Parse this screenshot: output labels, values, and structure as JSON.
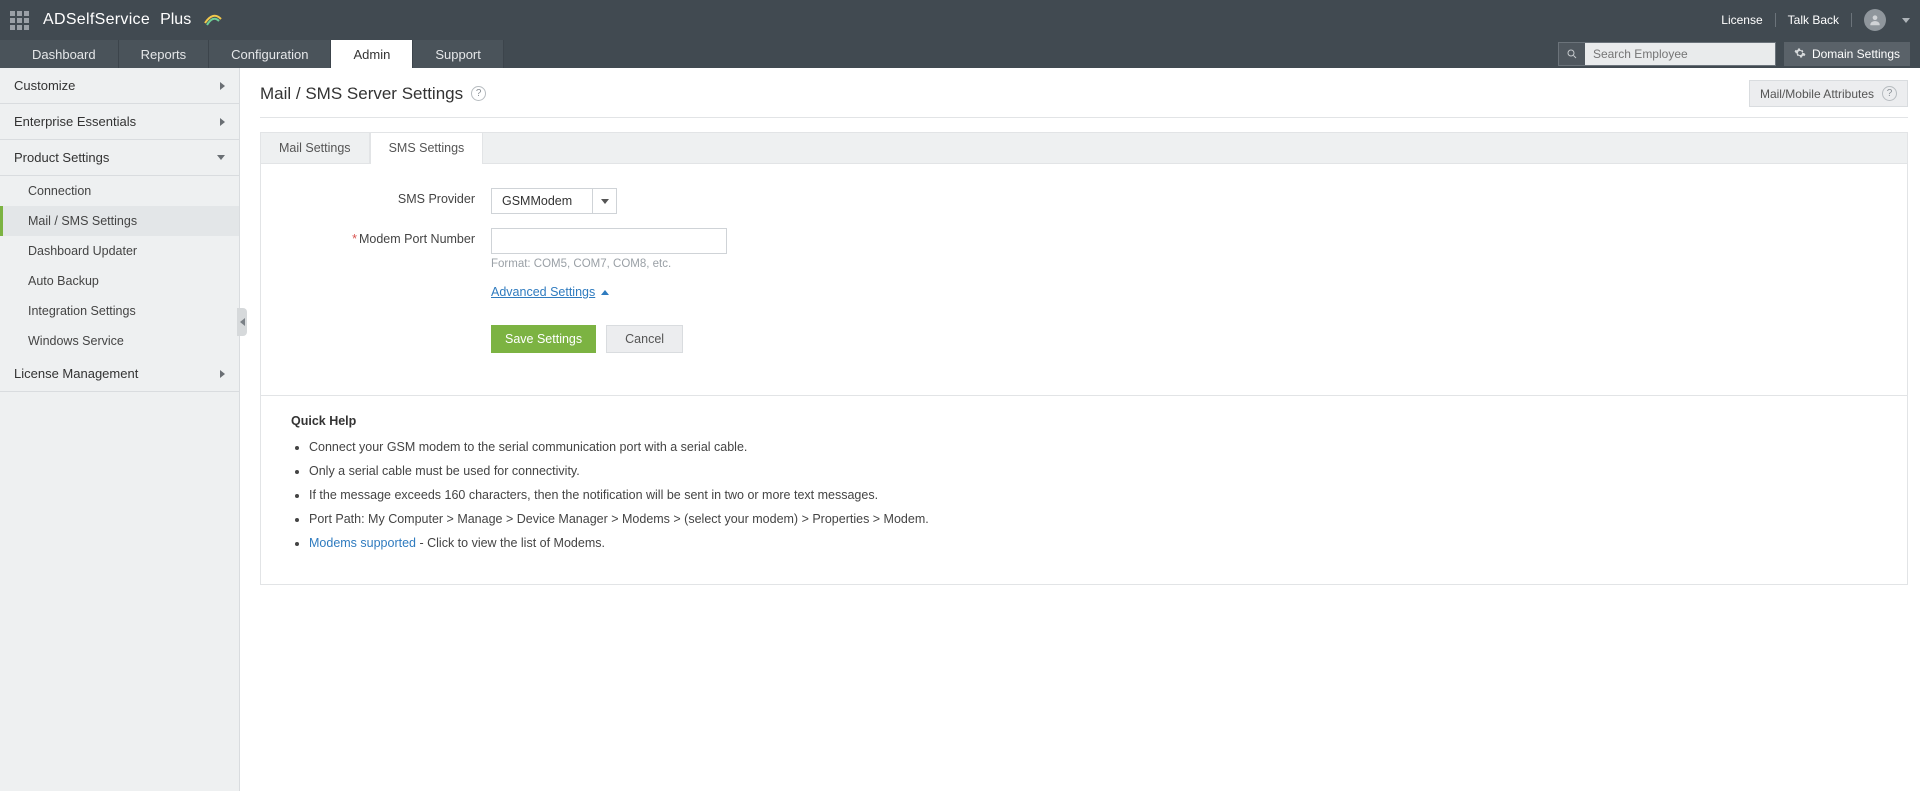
{
  "header": {
    "product_name": "ADSelfService",
    "product_suffix": "Plus",
    "license_link": "License",
    "talkback_link": "Talk Back",
    "search_placeholder": "Search Employee",
    "domain_settings": "Domain Settings"
  },
  "nav": {
    "tabs": [
      "Dashboard",
      "Reports",
      "Configuration",
      "Admin",
      "Support"
    ],
    "active": "Admin"
  },
  "sidebar": {
    "groups": [
      {
        "label": "Customize",
        "expanded": false
      },
      {
        "label": "Enterprise Essentials",
        "expanded": false
      },
      {
        "label": "Product Settings",
        "expanded": true,
        "items": [
          {
            "label": "Connection"
          },
          {
            "label": "Mail / SMS Settings",
            "active": true
          },
          {
            "label": "Dashboard Updater"
          },
          {
            "label": "Auto Backup"
          },
          {
            "label": "Integration Settings"
          },
          {
            "label": "Windows Service"
          }
        ]
      },
      {
        "label": "License Management",
        "expanded": false
      }
    ]
  },
  "page": {
    "title": "Mail / SMS Server Settings",
    "attr_button": "Mail/Mobile Attributes"
  },
  "panel": {
    "tabs": [
      "Mail Settings",
      "SMS Settings"
    ],
    "active": "SMS Settings"
  },
  "form": {
    "sms_provider_label": "SMS Provider",
    "sms_provider_value": "GSMModem",
    "modem_port_label": "Modem Port Number",
    "modem_port_value": "",
    "modem_port_hint": "Format: COM5, COM7, COM8, etc.",
    "advanced_link": "Advanced Settings",
    "save_label": "Save Settings",
    "cancel_label": "Cancel"
  },
  "quickhelp": {
    "title": "Quick Help",
    "items": [
      "Connect your GSM modem to the serial communication port with a serial cable.",
      "Only a serial cable must be used for connectivity.",
      "If the message exceeds 160 characters, then the notification will be sent in two or more text messages.",
      "Port Path: My Computer > Manage > Device Manager > Modems > (select your modem) > Properties > Modem."
    ],
    "modems_link": "Modems supported",
    "modems_suffix": " - Click to view the list of Modems."
  }
}
